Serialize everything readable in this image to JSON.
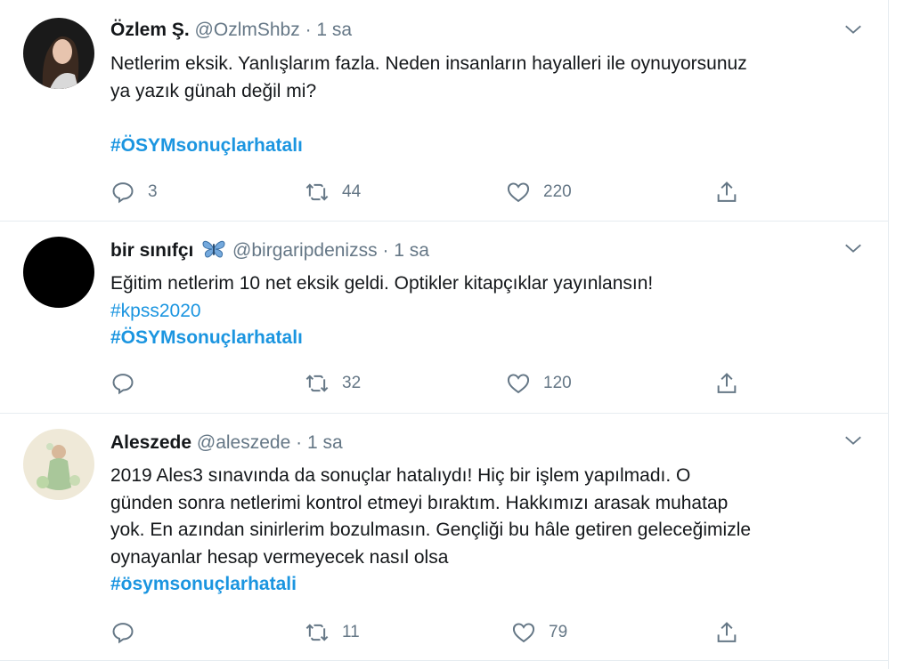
{
  "tweets": [
    {
      "name": "Özlem Ş.",
      "handle": "@OzlmShbz",
      "sep": "·",
      "time": "1 sa",
      "lines": [
        "Netlerim eksik. Yanlışlarım fazla. Neden insanların hayalleri ile oynuyorsunuz",
        "ya yazık günah değil mi?"
      ],
      "hashtags": [
        "#ÖSYMsonuçlarhatalı"
      ],
      "replies": "3",
      "retweets": "44",
      "likes": "220"
    },
    {
      "name": "bir sınıfçı",
      "name_emoji": "butterfly-emoji",
      "handle": "@birgaripdenizss",
      "sep": "·",
      "time": "1 sa",
      "lines": [
        "Eğitim netlerim 10 net eksik geldi. Optikler kitapçıklar yayınlansın!"
      ],
      "hashtags": [
        "#kpss2020",
        "#ÖSYMsonuçlarhatalı"
      ],
      "replies": "",
      "retweets": "32",
      "likes": "120"
    },
    {
      "name": "Aleszede",
      "handle": "@aleszede",
      "sep": "·",
      "time": "1 sa",
      "lines": [
        "2019 Ales3 sınavında da sonuçlar hatalıydı! Hiç bir işlem yapılmadı. O",
        "günden sonra netlerimi kontrol etmeyi bıraktım. Hakkımızı arasak muhatap",
        "yok. En azından sinirlerim bozulmasın. Gençliği bu hâle getiren geleceğimizle",
        "oynayanlar hesap vermeyecek nasıl olsa"
      ],
      "hashtags": [
        "#ösymsonuçlarhatali"
      ],
      "replies": "",
      "retweets": "11",
      "likes": "79"
    }
  ],
  "colors": {
    "link": "#1b95e0",
    "muted": "#657786",
    "text": "#14171a",
    "divider": "#e6ecf0"
  },
  "icons": [
    "chevron-down-icon",
    "reply-icon",
    "retweet-icon",
    "like-icon",
    "share-icon"
  ]
}
